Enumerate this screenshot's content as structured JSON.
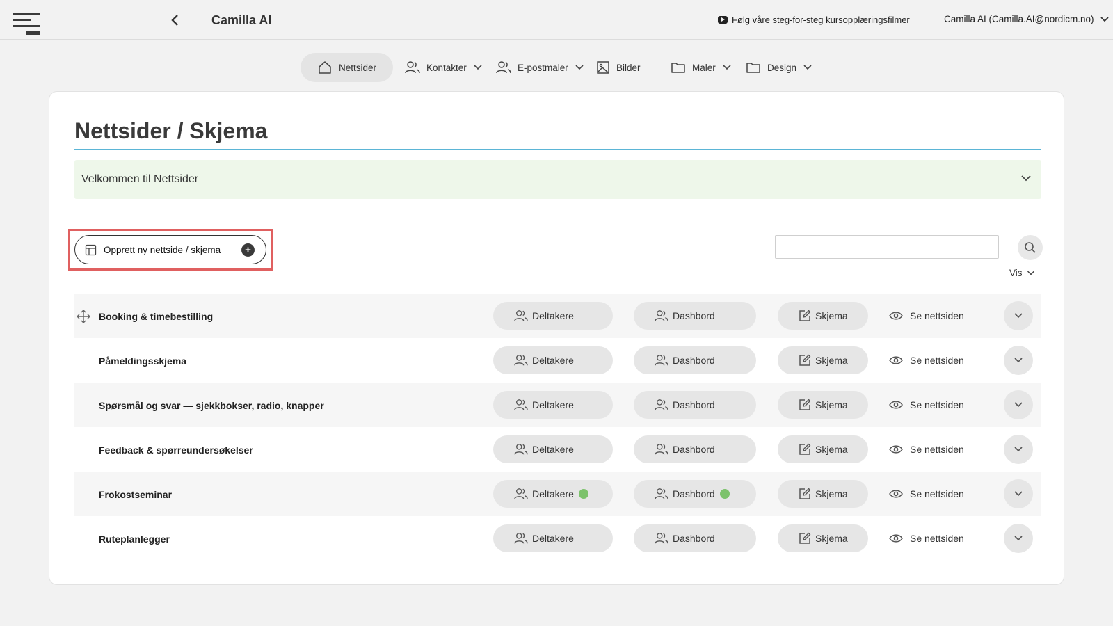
{
  "header": {
    "app_title": "Camilla AI",
    "tutorial_link": "Følg våre steg-for-steg kursopplæringsfilmer",
    "user": "Camilla AI (Camilla.AI@nordicm.no)"
  },
  "nav": {
    "items": [
      {
        "label": "Nettsider",
        "icon": "home-icon",
        "active": true
      },
      {
        "label": "Kontakter",
        "icon": "users-icon",
        "dropdown": true
      },
      {
        "label": "E-postmaler",
        "icon": "users-icon",
        "dropdown": true
      },
      {
        "label": "Bilder",
        "icon": "image-icon"
      },
      {
        "label": "Maler",
        "icon": "folder-icon",
        "dropdown": true
      },
      {
        "label": "Design",
        "icon": "folder-icon",
        "dropdown": true
      }
    ]
  },
  "main": {
    "title": "Nettsider / Skjema",
    "welcome": "Velkommen til Nettsider",
    "create_button": "Opprett ny nettside / skjema",
    "search": {
      "value": "",
      "placeholder": ""
    },
    "vis_label": "Vis",
    "actions": {
      "participants": "Deltakere",
      "dashboard": "Dashbord",
      "form": "Skjema",
      "view": "Se nettsiden"
    },
    "rows": [
      {
        "name": "Booking & timebestilling",
        "new_activity": false
      },
      {
        "name": "Påmeldingsskjema",
        "new_activity": false
      },
      {
        "name": "Spørsmål og svar — sjekkbokser, radio, knapper",
        "new_activity": false
      },
      {
        "name": "Feedback & spørreundersøkelser",
        "new_activity": false
      },
      {
        "name": "Frokostseminar",
        "new_activity": true
      },
      {
        "name": "Ruteplanlegger",
        "new_activity": false
      }
    ]
  },
  "colors": {
    "accent_rule": "#5bb5d6",
    "welcome_bg": "#eef7ea",
    "highlight": "#e06060",
    "status_dot": "#7cc26b"
  }
}
